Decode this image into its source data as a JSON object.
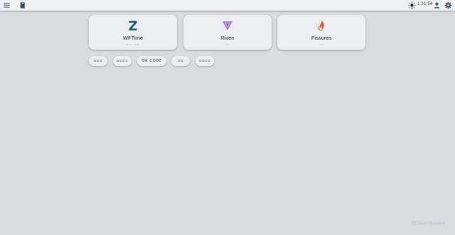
{
  "topbar": {
    "menu_icon": "menu-icon",
    "book_icon": "book-icon",
    "theme_icon": "sun-icon",
    "clock": "1:31:54",
    "user_icon": "account-icon",
    "settings_icon": "gear-icon"
  },
  "cards": [
    {
      "title": "WFTime",
      "subtitle": "▫▫▫▫▫ ▫▫▫▫▫",
      "icon": "z-logo-icon",
      "color": "#1d5b70"
    },
    {
      "title": "Riven",
      "subtitle": "▫▫▫",
      "icon": "riven-icon",
      "color": "#a67ad6"
    },
    {
      "title": "Fissures",
      "subtitle": "▫▫▫",
      "icon": "flame-icon",
      "color": "#d2622c"
    }
  ],
  "buttons": [
    {
      "label": "▫▫▫"
    },
    {
      "label": "▫▫▫▫"
    },
    {
      "label": "QR CODE"
    },
    {
      "label": "▫▫"
    },
    {
      "label": "▫▫▫▫"
    }
  ],
  "watermark": {
    "text": "ScanMalware"
  }
}
